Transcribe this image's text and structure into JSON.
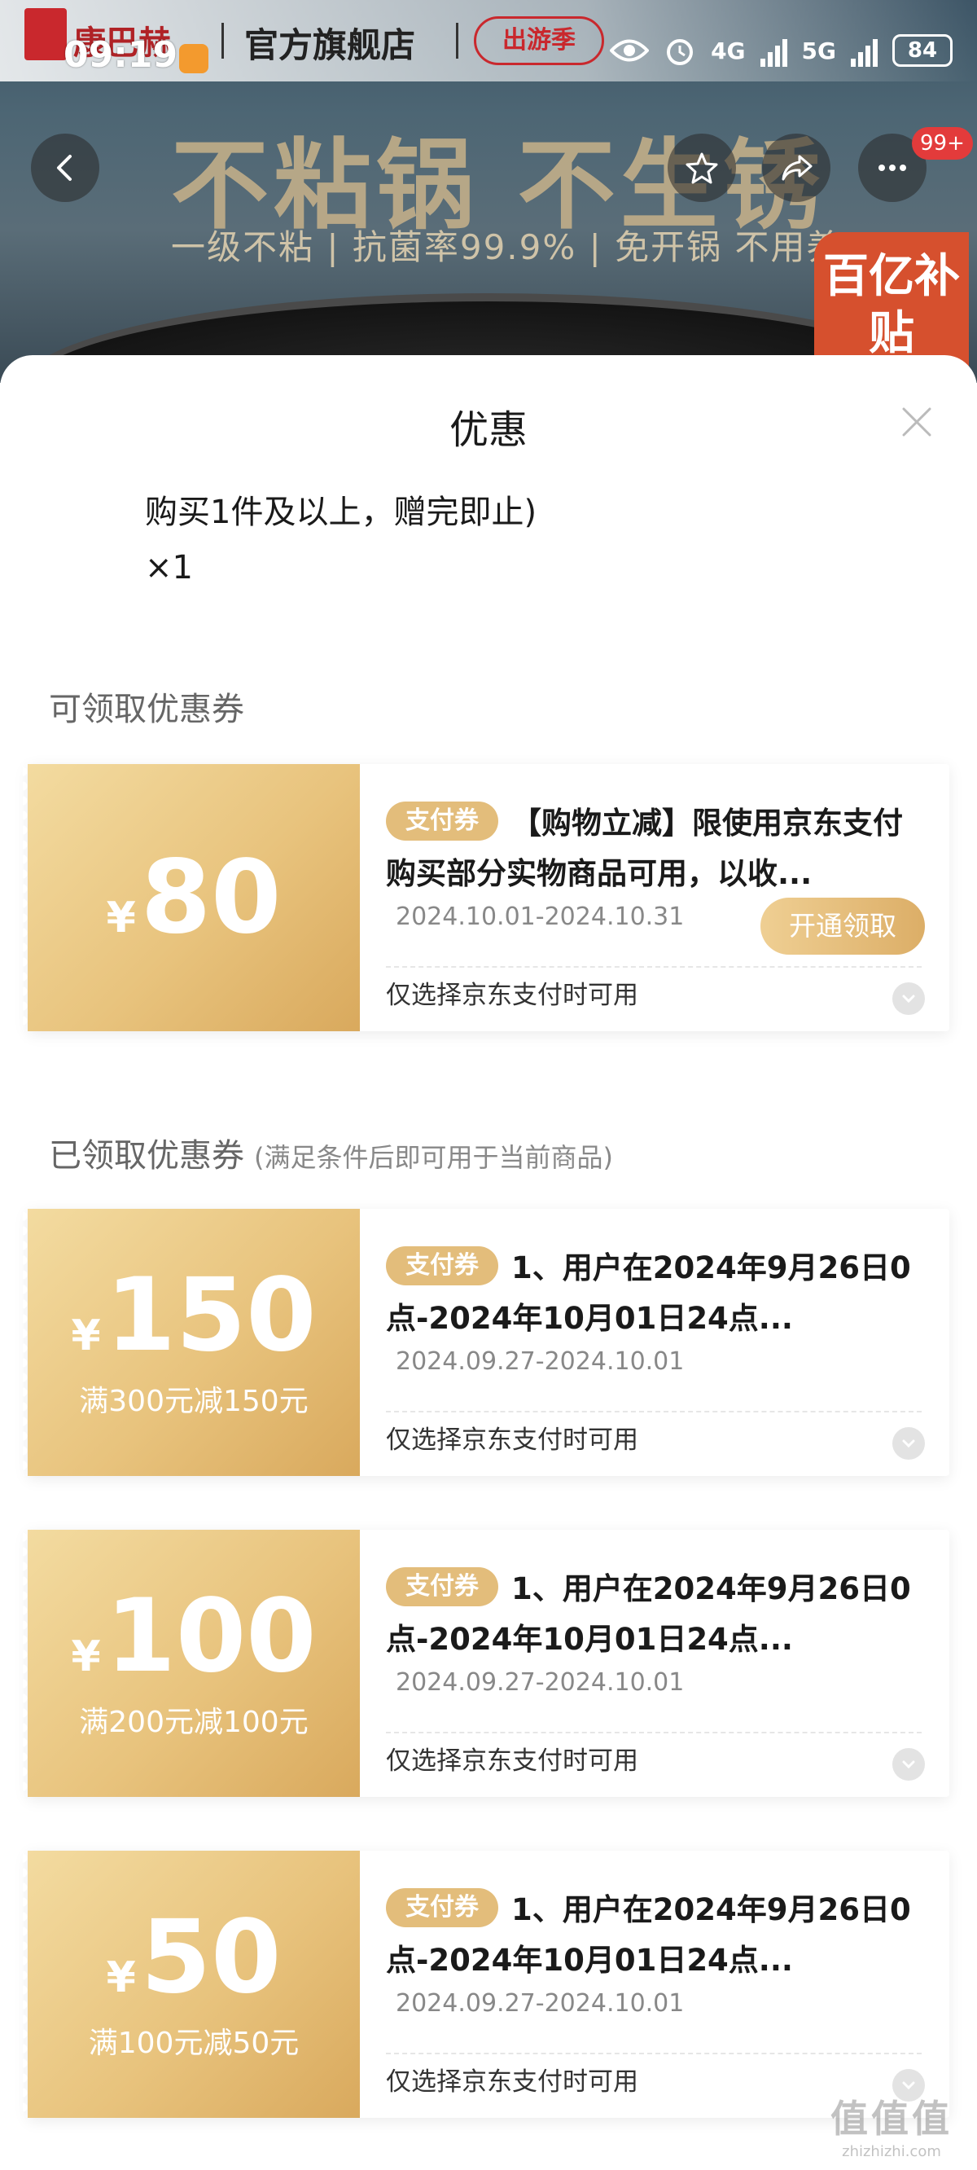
{
  "status_bar": {
    "time": "09:19",
    "network1": "4G",
    "network2": "5G",
    "battery": "84"
  },
  "banner": {
    "brand": "康巴赫",
    "shop_name": "官方旗舰店",
    "shop_tag": "出游季",
    "headline": "不粘锅 不生锈",
    "subline": "一级不粘 | 抗菌率99.9% | 免开锅 不用养",
    "badge": "百亿补贴",
    "msg_count": "99+"
  },
  "sheet": {
    "title": "优惠",
    "gift_line": "购买1件及以上，赠完即止)",
    "gift_qty": "×1"
  },
  "available_section": {
    "title": "可领取优惠券"
  },
  "claimed_section": {
    "title": "已领取优惠券",
    "note": "(满足条件后即可用于当前商品)"
  },
  "coupons_available": [
    {
      "currency": "¥",
      "amount": "80",
      "condition": "",
      "tag": "支付券",
      "title": "【购物立减】限使用京东支付购买部分实物商品可用，以收...",
      "date": "2024.10.01-2024.10.31",
      "limit": "仅选择京东支付时可用",
      "action": "开通领取"
    }
  ],
  "coupons_claimed": [
    {
      "currency": "¥",
      "amount": "150",
      "condition": "满300元减150元",
      "tag": "支付券",
      "title": "1、用户在2024年9月26日0点-2024年10月01日24点...",
      "date": "2024.09.27-2024.10.01",
      "limit": "仅选择京东支付时可用"
    },
    {
      "currency": "¥",
      "amount": "100",
      "condition": "满200元减100元",
      "tag": "支付券",
      "title": "1、用户在2024年9月26日0点-2024年10月01日24点...",
      "date": "2024.09.27-2024.10.01",
      "limit": "仅选择京东支付时可用"
    },
    {
      "currency": "¥",
      "amount": "50",
      "condition": "满100元减50元",
      "tag": "支付券",
      "title": "1、用户在2024年9月26日0点-2024年10月01日24点...",
      "date": "2024.09.27-2024.10.01",
      "limit": "仅选择京东支付时可用"
    }
  ],
  "watermark": {
    "main": "值值值",
    "sub": "zhizhizhi.com"
  },
  "colors": {
    "coupon_gold": "#e3bd7b",
    "coupon_gradient_end": "#d9a95d",
    "text_primary": "#1a1a1a",
    "text_muted": "#888888"
  }
}
